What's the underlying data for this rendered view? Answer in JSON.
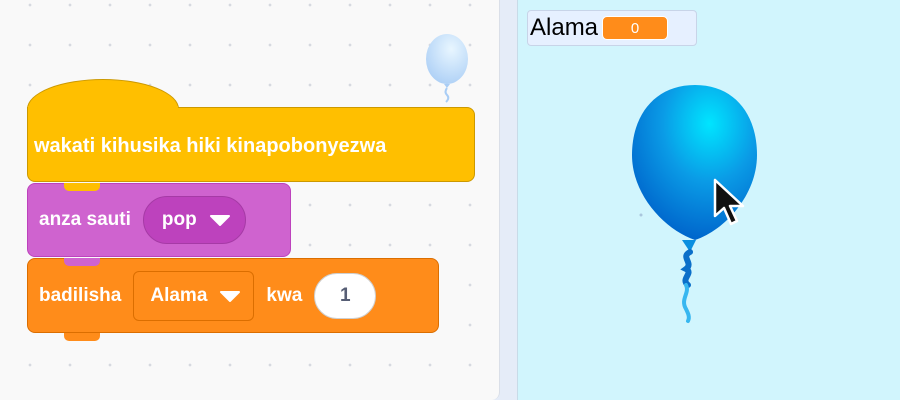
{
  "code_area": {
    "sprite_thumbnail": "balloon-sprite-thumbnail",
    "blocks": {
      "event_hat": {
        "label": "wakati kihusika hiki kinapobonyezwa",
        "color": "#ffbf00"
      },
      "play_sound": {
        "label": "anza sauti",
        "sound_value": "pop",
        "color": "#cf63cf"
      },
      "change_variable": {
        "label": "badilisha",
        "variable": "Alama",
        "by_label": "kwa",
        "amount": "1",
        "color": "#ff8c1a"
      }
    }
  },
  "stage": {
    "background_color": "#d1f5fd",
    "monitor": {
      "label": "Alama",
      "value": "0"
    },
    "sprite": "blue-balloon",
    "sprite_color": "#0a8fe0"
  }
}
